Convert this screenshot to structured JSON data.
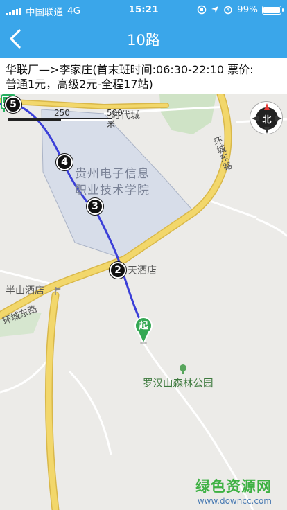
{
  "status_bar": {
    "carrier": "中国联通",
    "network": "4G",
    "time": "15:21",
    "battery": "99%",
    "battery_level": 0.99
  },
  "header": {
    "title": "10路",
    "back_icon": "chevron-left-icon"
  },
  "route_info": {
    "line1": "华联厂—>李家庄(首末班时间:06:30-22:10 票价:",
    "line2": "普通1元，高级2元-全程17站)"
  },
  "map": {
    "scale": {
      "label_250": "250",
      "label_500": "500 米"
    },
    "compass_label": "北",
    "labels": {
      "times_city": "时代城",
      "campus_line1": "贵州电子信息",
      "campus_line2": "职业技术学院",
      "hotel_partial": "天酒店",
      "banshan_hotel": "半山酒店",
      "ring_road_east_right": "环城东路",
      "ring_road_east_left": "环城东路",
      "luohan_park": "罗汉山森林公园"
    },
    "stops": [
      {
        "label": "5"
      },
      {
        "label": "4"
      },
      {
        "label": "3"
      },
      {
        "label": "2"
      }
    ],
    "start_marker": "起"
  },
  "watermark": {
    "line1": "绿色资源网",
    "line2": "www.downcc.com"
  },
  "colors": {
    "accent": "#3aa6ea",
    "route": "#3b3fd8",
    "road_major": "#f2d76b",
    "road_border": "#d9b84a",
    "campus_fill": "#d7dde9",
    "park_green": "#cfe3c6",
    "start_green": "#34a853"
  }
}
